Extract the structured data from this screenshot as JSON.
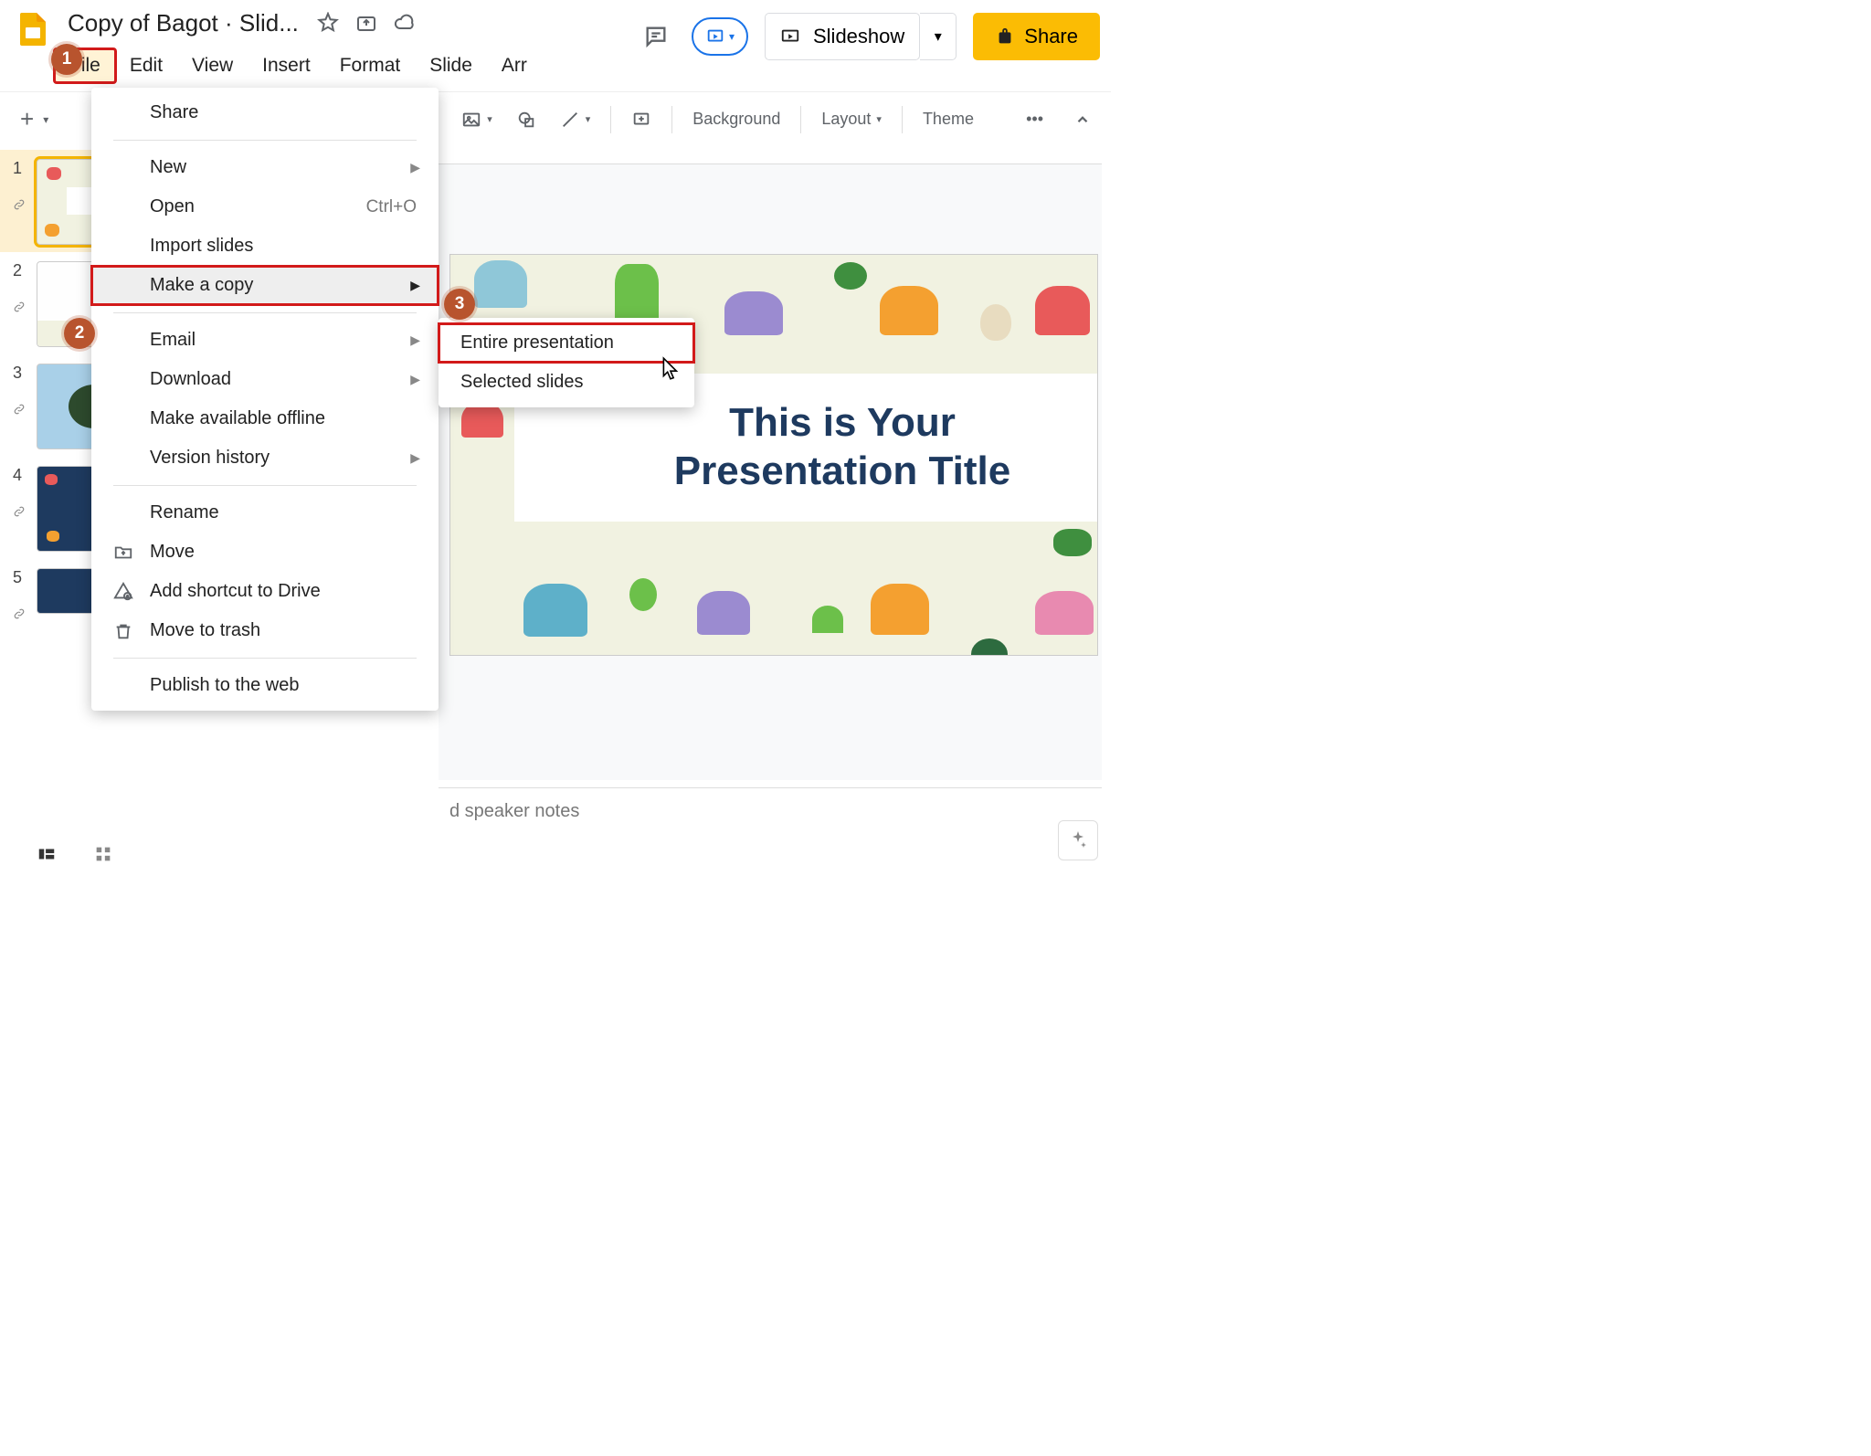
{
  "doc_title": "Copy of Bagot · Slid...",
  "menubar": [
    "File",
    "Edit",
    "View",
    "Insert",
    "Format",
    "Slide",
    "Arr"
  ],
  "right": {
    "slideshow": "Slideshow",
    "share": "Share"
  },
  "toolbar": {
    "background": "Background",
    "layout": "Layout",
    "theme": "Theme"
  },
  "file_menu": {
    "share": "Share",
    "new": "New",
    "open": "Open",
    "open_sc": "Ctrl+O",
    "import": "Import slides",
    "makecopy": "Make a copy",
    "email": "Email",
    "download": "Download",
    "offline": "Make available offline",
    "version": "Version history",
    "rename": "Rename",
    "move": "Move",
    "shortcut": "Add shortcut to Drive",
    "trash": "Move to trash",
    "publish": "Publish to the web"
  },
  "submenu": {
    "entire": "Entire presentation",
    "selected": "Selected slides"
  },
  "slide_title_l1": "This is Your",
  "slide_title_l2": "Presentation Title",
  "notes_placeholder": "d speaker notes",
  "thumbs": [
    1,
    2,
    3,
    4,
    5
  ],
  "callouts": {
    "c1": "1",
    "c2": "2",
    "c3": "3"
  }
}
